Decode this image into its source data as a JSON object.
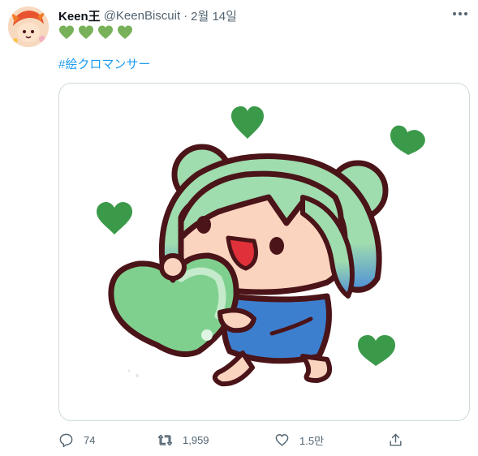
{
  "tweet": {
    "display_name": "Keen王",
    "handle": "@KeenBiscuit",
    "separator": "·",
    "date": "2월 14일",
    "emojis": [
      "green-heart",
      "green-heart",
      "green-heart",
      "green-heart"
    ],
    "hashtag": "#絵クロマンサー"
  },
  "actions": {
    "reply_count": "74",
    "retweet_count": "1,959",
    "like_count": "1.5만"
  },
  "colors": {
    "accent": "#1d9bf0",
    "heart_green": "#3b9a4a",
    "hair_green": "#9fdcae",
    "dress_blue": "#3d7fcf",
    "outline": "#4a1418"
  }
}
